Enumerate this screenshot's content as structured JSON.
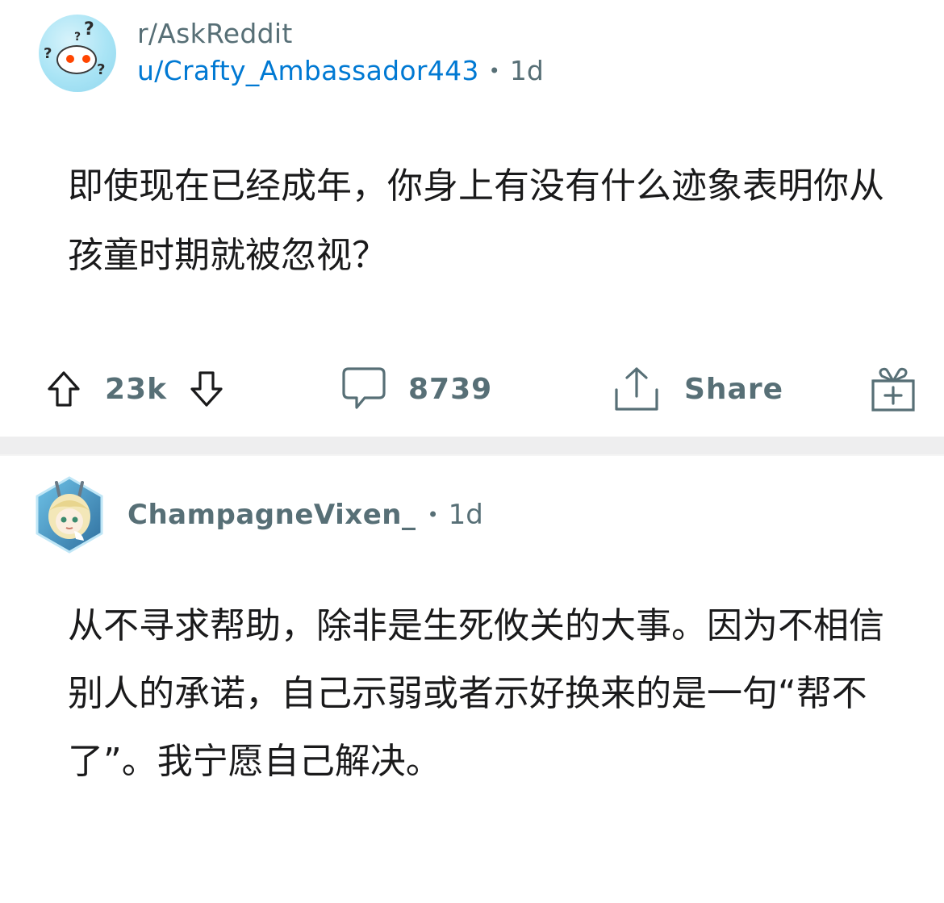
{
  "post": {
    "subreddit": "r/AskReddit",
    "author": "u/Crafty_Ambassador443",
    "separator": "•",
    "age": "1d",
    "title": "即使现在已经成年，你身上有没有什么迹象表明你从孩童时期就被忽视？",
    "avatar_icon": "snoo-question-icon",
    "actions": {
      "upvote_icon": "upvote-arrow-icon",
      "vote_count": "23k",
      "downvote_icon": "downvote-arrow-icon",
      "comment_icon": "comment-bubble-icon",
      "comment_count": "8739",
      "share_icon": "share-upload-icon",
      "share_label": "Share",
      "award_icon": "gift-award-icon"
    }
  },
  "comment": {
    "author": "ChampagneVixen_",
    "separator": "•",
    "age": "1d",
    "body": "从不寻求帮助，除非是生死攸关的大事。因为不相信别人的承诺，自己示弱或者示好换来的是一句“帮不了”。我宁愿自己解决。",
    "avatar_icon": "hexagon-anime-avatar"
  },
  "colors": {
    "meta_gray": "#576f76",
    "author_blue": "#0079d3",
    "text": "#1a1a1b",
    "divider": "#eeeeef"
  }
}
